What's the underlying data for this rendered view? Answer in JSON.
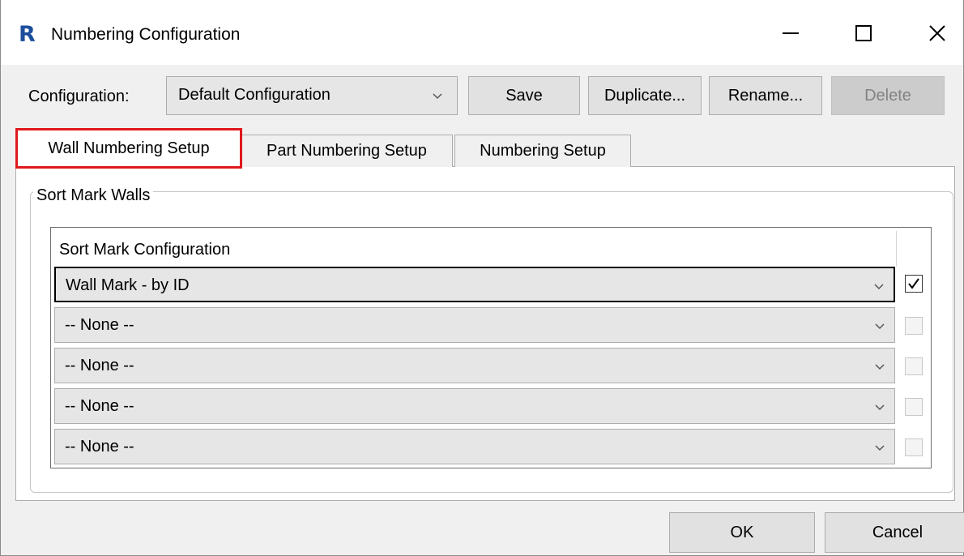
{
  "window": {
    "title": "Numbering Configuration",
    "app_logo_letter": "R",
    "controls": [
      "minimize-icon",
      "maximize-icon",
      "close-icon"
    ]
  },
  "config": {
    "label": "Configuration:",
    "selected": "Default Configuration",
    "buttons": {
      "save": "Save",
      "duplicate": "Duplicate...",
      "rename": "Rename...",
      "delete": "Delete"
    }
  },
  "tabs": [
    {
      "label": "Wall Numbering Setup",
      "active": true,
      "highlight_color": "#e0181c"
    },
    {
      "label": "Part Numbering Setup",
      "active": false
    },
    {
      "label": "Numbering Setup",
      "active": false
    }
  ],
  "group": {
    "legend": "Sort Mark Walls",
    "grid": {
      "header": "Sort Mark Configuration",
      "rows": [
        {
          "value": "Wall Mark - by ID",
          "checked": true
        },
        {
          "value": "-- None --",
          "checked": false
        },
        {
          "value": "-- None --",
          "checked": false
        },
        {
          "value": "-- None --",
          "checked": false
        },
        {
          "value": "-- None --",
          "checked": false
        }
      ]
    }
  },
  "footer": {
    "ok": "OK",
    "cancel": "Cancel"
  },
  "colors": {
    "brand": "#1b4f9c",
    "highlight": "#e0181c"
  }
}
